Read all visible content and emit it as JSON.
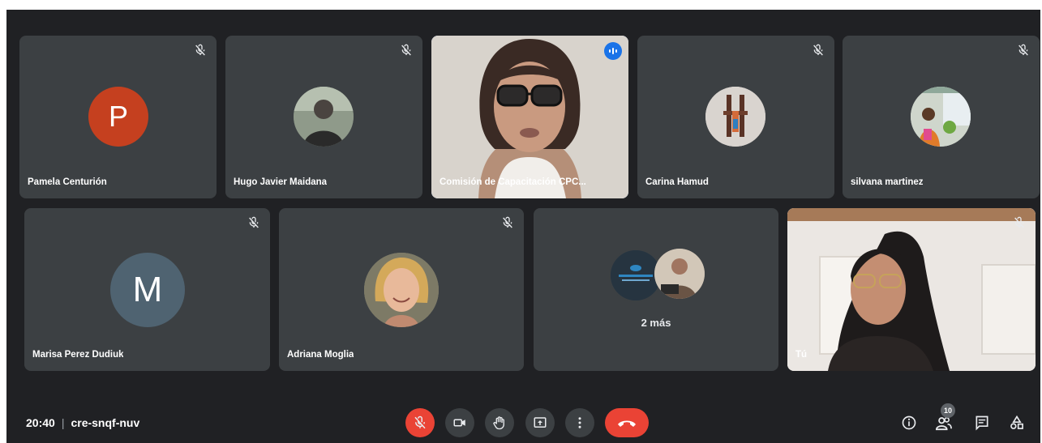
{
  "participants": [
    {
      "name": "Pamela Centurión",
      "initial": "P",
      "avatar_color": "#c5401f",
      "muted": true
    },
    {
      "name": "Hugo Javier Maidana",
      "muted": true
    },
    {
      "name": "Comisión de Capacitación CPC...",
      "speaking": true
    },
    {
      "name": "Carina Hamud",
      "muted": true
    },
    {
      "name": "silvana martinez",
      "muted": true
    },
    {
      "name": "Marisa Perez Dudiuk",
      "initial": "M",
      "avatar_color": "#4f6371",
      "muted": true
    },
    {
      "name": "Adriana Moglia",
      "muted": true
    },
    {
      "more_label": "2 más"
    },
    {
      "name": "Tú",
      "muted": true
    }
  ],
  "bottom_bar": {
    "time": "20:40",
    "separator": "|",
    "meeting_code": "cre-snqf-nuv",
    "people_count": "10"
  },
  "colors": {
    "background": "#202124",
    "tile": "#3c4043",
    "active_outline": "#8ab4f8",
    "danger": "#ea4335",
    "speaking_badge": "#1a73e8"
  },
  "icons": {
    "mic": "mic-off-icon",
    "camera": "camera-icon",
    "hand": "raise-hand-icon",
    "present": "present-screen-icon",
    "more": "more-options-icon",
    "hangup": "hang-up-icon",
    "info": "info-icon",
    "people": "people-icon",
    "chat": "chat-icon",
    "activities": "activities-icon"
  }
}
